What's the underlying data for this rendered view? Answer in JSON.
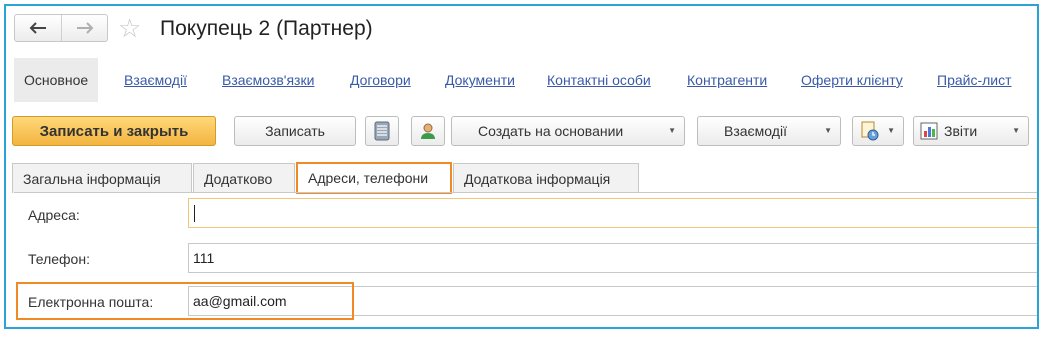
{
  "window": {
    "title": "Покупець 2 (Партнер)",
    "back_icon": "arrow-left-icon",
    "forward_icon": "arrow-right-icon",
    "favorite_icon": "star-icon"
  },
  "links": {
    "main": "Основное",
    "items": [
      "Взаємодії",
      "Взаємозв'язки",
      "Договори",
      "Документи",
      "Контактні особи",
      "Контрагенти",
      "Оферти клієнту",
      "Прайс-лист"
    ]
  },
  "toolbar": {
    "save_close": "Записать и закрыть",
    "save": "Записать",
    "create_based": "Создать на основании",
    "interactions": "Взаємодії",
    "reports": "Звіти"
  },
  "tabs": [
    "Загальна інформація",
    "Додатково",
    "Адреси, телефони",
    "Додаткова інформація"
  ],
  "active_tab": "Адреси, телефони",
  "form": {
    "address_label": "Адреса:",
    "address_value": "",
    "phone_label": "Телефон:",
    "phone_value": "111",
    "email_label": "Електронна пошта:",
    "email_value": "aa@gmail.com"
  },
  "colors": {
    "frame_border": "#2aa3d6",
    "highlight": "#f08a24",
    "link": "#3a5aa8",
    "primary_button": "#f3b43f"
  }
}
